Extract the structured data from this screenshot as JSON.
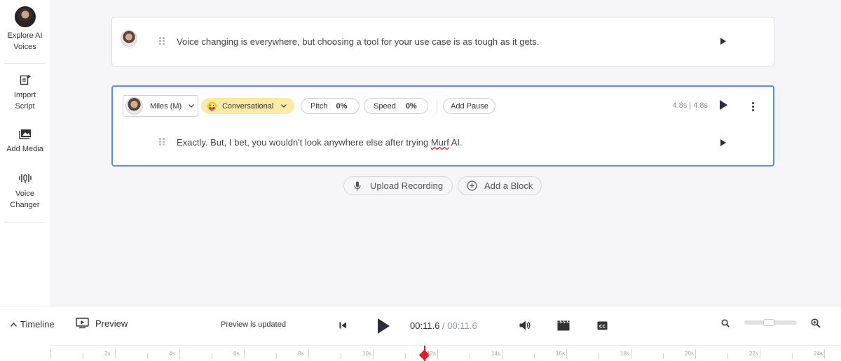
{
  "sidebar": {
    "items": [
      {
        "label_line1": "Explore AI",
        "label_line2": "Voices",
        "icon": "avatar"
      },
      {
        "label_line1": "Import",
        "label_line2": "Script",
        "icon": "import-script-icon"
      },
      {
        "label_line1": "Add Media",
        "label_line2": "",
        "icon": "add-media-icon"
      },
      {
        "label_line1": "Voice",
        "label_line2": "Changer",
        "icon": "voice-changer-icon"
      }
    ]
  },
  "blocks": [
    {
      "text": "Voice changing is everywhere, but choosing a tool for your use case is as tough as it gets."
    },
    {
      "voice": "Miles (M)",
      "style_emoji": "😜",
      "style": "Conversational",
      "pitch_label": "Pitch",
      "pitch_value": "0%",
      "speed_label": "Speed",
      "speed_value": "0%",
      "add_pause": "Add Pause",
      "duration": "4.8s | 4.8s",
      "text_before": "Exactly. But, I bet, you wouldn't look anywhere else after trying ",
      "text_misspelled": "Murf",
      "text_after": " AI."
    }
  ],
  "actions": {
    "upload_recording": "Upload Recording",
    "add_block": "Add a Block"
  },
  "bottom_bar": {
    "timeline_label": "Timeline",
    "preview_label": "Preview",
    "status": "Preview is updated",
    "time_current": "00:11.6",
    "time_separator": "/",
    "time_total": "00:11.6",
    "zoom_level": 0.45
  },
  "timeline": {
    "labels": [
      "2s",
      "4s",
      "6s",
      "8s",
      "10s",
      "12s",
      "14s",
      "16s",
      "18s",
      "20s",
      "22s",
      "24s"
    ],
    "playhead_seconds": 11.6
  },
  "colors": {
    "accent_blue": "#5b8ee8",
    "style_pill_bg": "#fde9a8",
    "playhead": "#e11d2a"
  }
}
